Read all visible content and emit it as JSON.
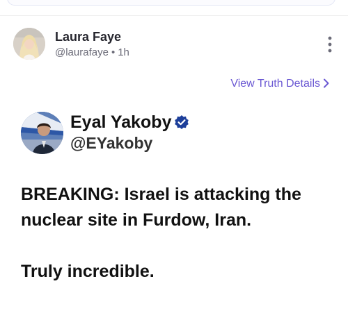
{
  "post": {
    "author_name": "Laura Faye",
    "author_handle": "@laurafaye",
    "separator": "•",
    "time_ago": "1h",
    "more_icon": "more-vertical-icon",
    "view_details_label": "View Truth Details",
    "view_details_icon": "chevron-right-icon",
    "accent_color": "#6b59d3"
  },
  "embedded": {
    "author_name": "Eyal Yakoby",
    "author_handle": "@EYakoby",
    "verified_icon": "verified-badge-icon",
    "verified_color": "#1d3f9a",
    "body_lines": [
      "BREAKING: Israel is attacking the nuclear site in Furdow, Iran.",
      "Truly incredible."
    ]
  }
}
